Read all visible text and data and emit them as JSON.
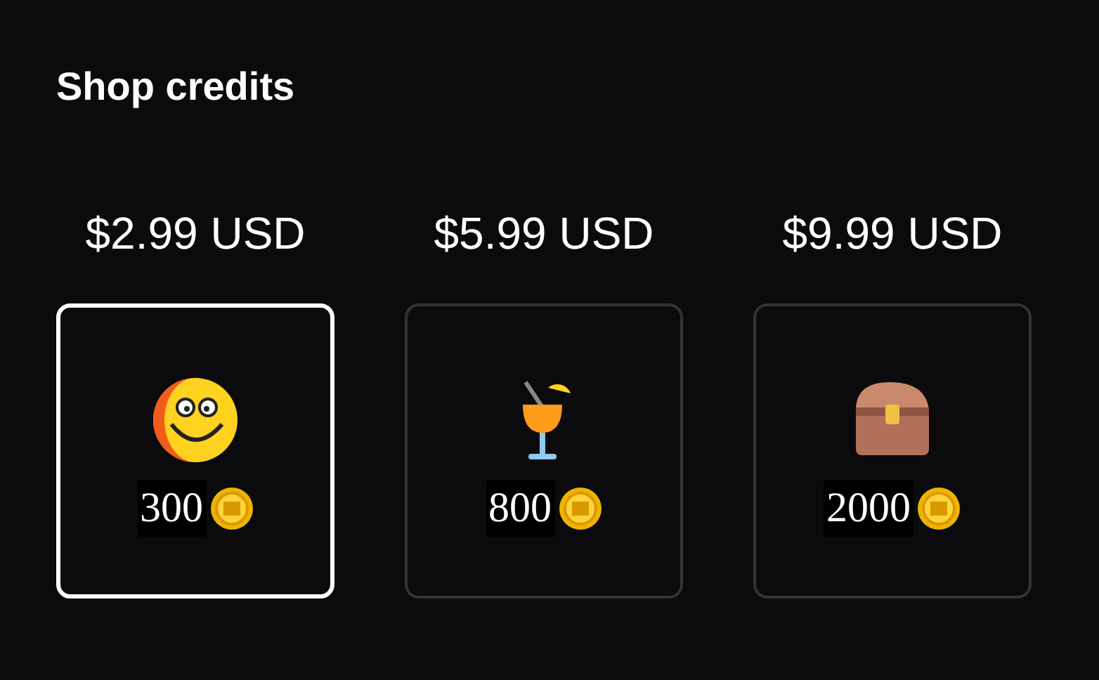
{
  "title": "Shop credits",
  "packages": [
    {
      "price": "$2.99 USD",
      "kind": "smiley",
      "amount": "300",
      "selected": true
    },
    {
      "price": "$5.99 USD",
      "kind": "drink",
      "amount": "800",
      "selected": false
    },
    {
      "price": "$9.99 USD",
      "kind": "chest",
      "amount": "2000",
      "selected": false
    }
  ]
}
